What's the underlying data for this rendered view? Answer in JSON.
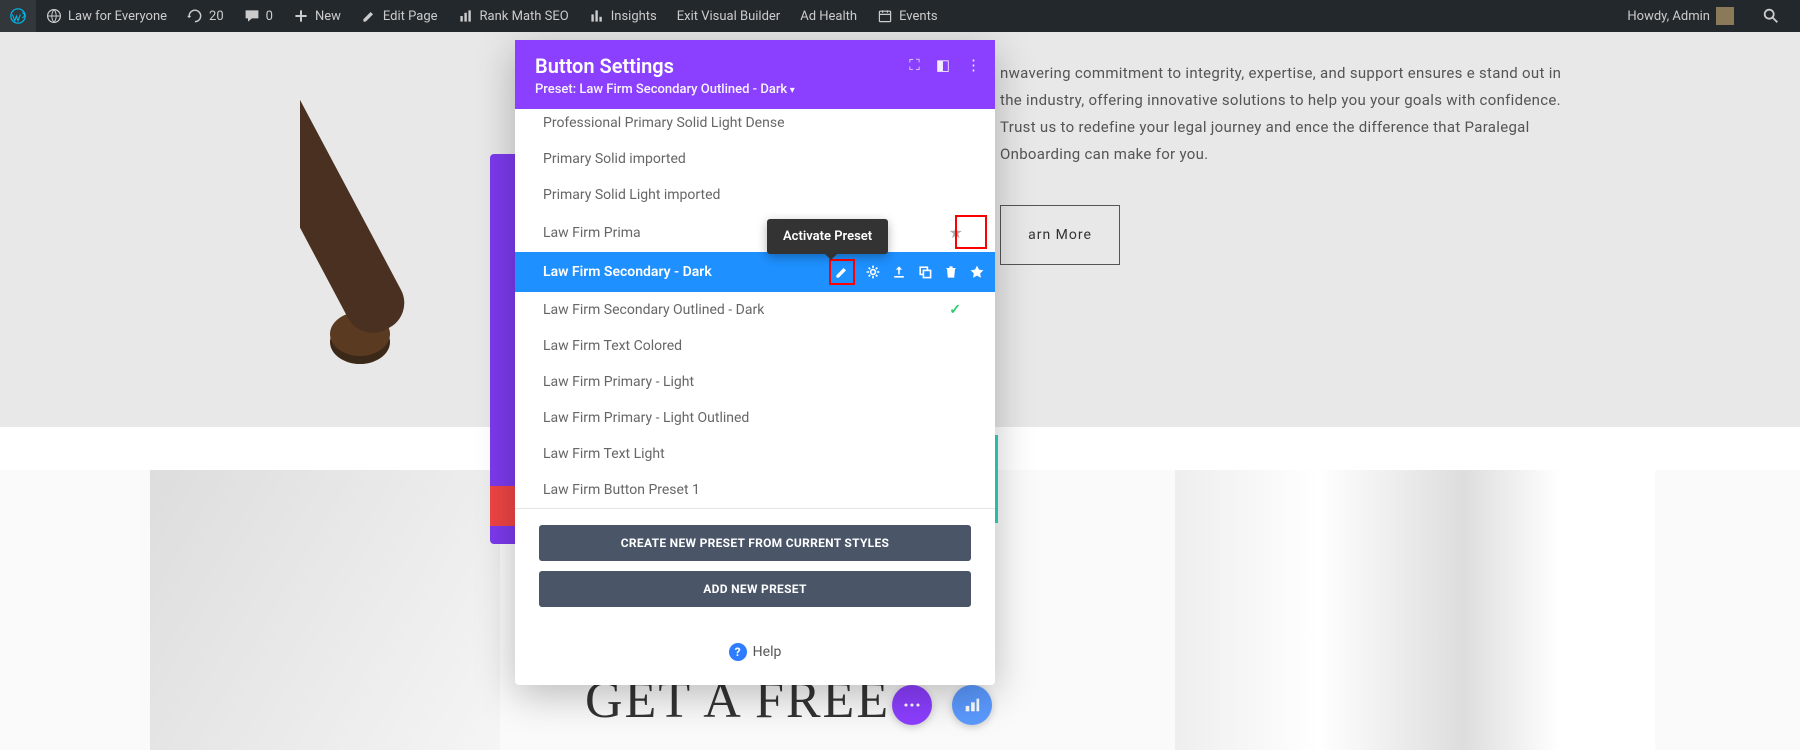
{
  "adminbar": {
    "site_name": "Law for Everyone",
    "updates": "20",
    "comments": "0",
    "new": "New",
    "edit_page": "Edit Page",
    "rank_math": "Rank Math SEO",
    "insights": "Insights",
    "exit_vb": "Exit Visual Builder",
    "ad_health": "Ad Health",
    "events": "Events",
    "howdy": "Howdy, Admin"
  },
  "content": {
    "paragraph": "nwavering commitment to integrity, expertise, and support ensures e stand out in the industry, offering innovative solutions to help you your goals with confidence. Trust us to redefine your legal journey and ence the difference that Paralegal Onboarding can make for you.",
    "learn_more": "arn More",
    "cta": "GET A FREE"
  },
  "modal": {
    "title": "Button Settings",
    "subtitle": "Preset: Law Firm Secondary Outlined - Dark",
    "tooltip": "Activate Preset",
    "presets": [
      "Professional Primary Solid Light Dense",
      "Primary Solid imported",
      "Primary Solid Light imported",
      "Law Firm Prima",
      "Law Firm Secondary - Dark",
      "Law Firm Secondary Outlined - Dark",
      "Law Firm Text Colored",
      "Law Firm Primary - Light",
      "Law Firm Primary - Light Outlined",
      "Law Firm Text Light",
      "Law Firm Button Preset 1"
    ],
    "create_preset": "CREATE NEW PRESET FROM CURRENT STYLES",
    "add_preset": "ADD NEW PRESET",
    "help": "Help"
  }
}
